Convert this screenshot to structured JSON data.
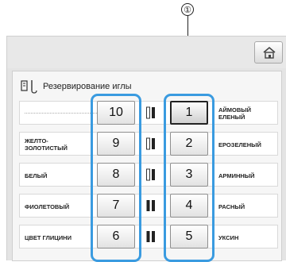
{
  "callout": {
    "number": "①"
  },
  "panel": {
    "title": "Резервирование иглы"
  },
  "left_labels": [
    "",
    "ЖЕЛТО-\nЗОЛОТИСТЫЙ",
    "БЕЛЫЙ",
    "ФИОЛЕТОВЫЙ",
    "ЦВЕТ ГЛИЦИНИ"
  ],
  "right_labels": [
    "АЙМОВЫЙ\nЕЛЕНЫЙ",
    "ЕРОЗЕЛЕНЫЙ",
    "АРМИННЫЙ",
    "РАСНЫЙ",
    "УКСИН"
  ],
  "left_buttons": [
    "10",
    "9",
    "8",
    "7",
    "6"
  ],
  "right_buttons": [
    "1",
    "2",
    "3",
    "4",
    "5"
  ],
  "spools": [
    "white-black",
    "white-black",
    "white-black",
    "black-black",
    "black-black"
  ],
  "colors": {
    "highlight": "#3a9be0",
    "screen_bg": "#e4e4e4"
  }
}
